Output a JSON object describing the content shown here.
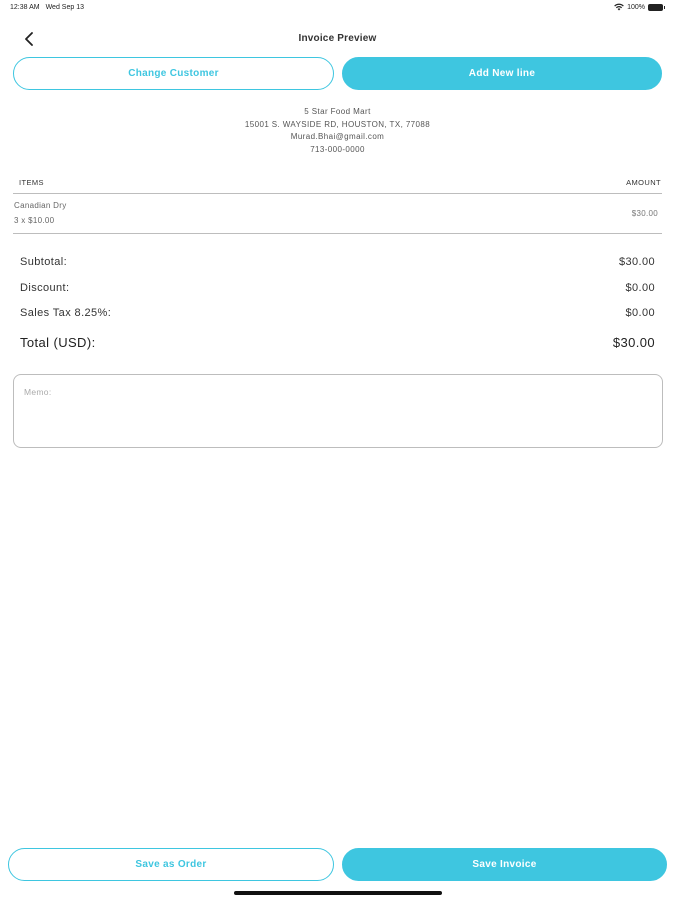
{
  "status_bar": {
    "time": "12:38 AM",
    "date": "Wed Sep 13",
    "battery": "100%",
    "wifi_icon": "wifi-icon",
    "battery_icon": "battery-icon"
  },
  "nav": {
    "title": "Invoice Preview",
    "back_icon": "chevron-left-icon"
  },
  "actions": {
    "change_customer": "Change Customer",
    "add_new_line": "Add New line"
  },
  "customer": {
    "name": "5 Star Food Mart",
    "address": "15001 S. WAYSIDE RD, HOUSTON, TX, 77088",
    "email": "Murad.Bhai@gmail.com",
    "phone": "713-000-0000"
  },
  "items_table": {
    "headers": {
      "items": "ITEMS",
      "amount": "AMOUNT"
    },
    "rows": [
      {
        "name": "Canadian Dry",
        "qty_line": "3 x $10.00",
        "amount": "$30.00"
      }
    ]
  },
  "totals": {
    "subtotal_label": "Subtotal:",
    "subtotal_value": "$30.00",
    "discount_label": "Discount:",
    "discount_value": "$0.00",
    "tax_label": "Sales Tax 8.25%:",
    "tax_value": "$0.00",
    "total_label": "Total (USD):",
    "total_value": "$30.00"
  },
  "memo": {
    "placeholder": "Memo:",
    "value": ""
  },
  "footer": {
    "save_order": "Save as Order",
    "save_invoice": "Save Invoice"
  },
  "colors": {
    "accent": "#3ec6e0",
    "divider": "#bdbdbd",
    "text": "#333333"
  }
}
